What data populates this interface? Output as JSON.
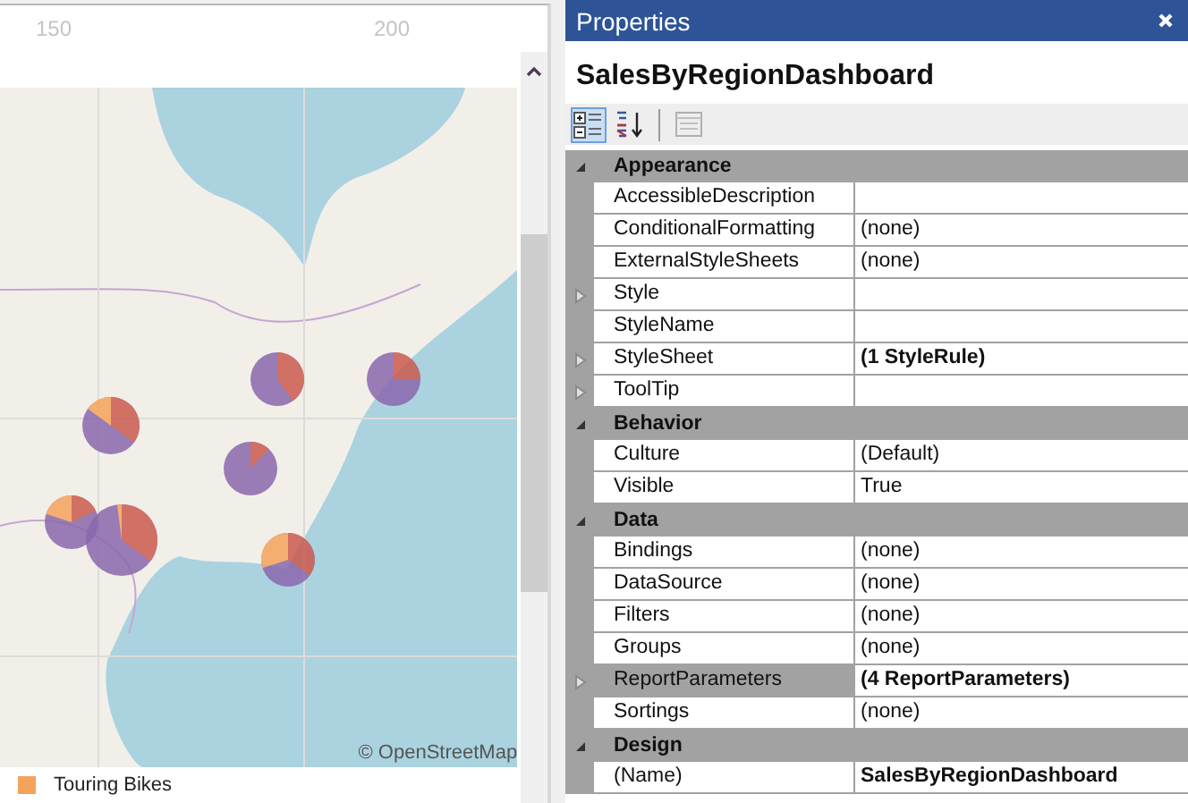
{
  "designer": {
    "ruler_ticks": [
      "150",
      "200"
    ],
    "map": {
      "kind": "picture",
      "attribution": "© OpenStreetMap"
    },
    "legend": [
      {
        "label": "Touring Bikes",
        "color": "#f5a35c"
      }
    ]
  },
  "properties": {
    "title": "Properties",
    "object_name": "SalesByRegionDashboard",
    "toolbar": [
      {
        "kind": "categorized",
        "selected": true
      },
      {
        "kind": "alphabetical",
        "selected": false
      },
      {
        "kind": "pages",
        "selected": false
      }
    ],
    "categories": [
      {
        "name": "Appearance",
        "expanded": true,
        "properties": [
          {
            "name": "AccessibleDescription",
            "expandable": false,
            "bold": false,
            "selected": false
          },
          {
            "name": "ConditionalFormatting",
            "value": "(none)",
            "expandable": false,
            "bold": false,
            "selected": false
          },
          {
            "name": "ExternalStyleSheets",
            "value": "(none)",
            "expandable": false,
            "bold": false,
            "selected": false
          },
          {
            "name": "Style",
            "expandable": true,
            "bold": false,
            "selected": false
          },
          {
            "name": "StyleName",
            "expandable": false,
            "bold": false,
            "selected": false
          },
          {
            "name": "StyleSheet",
            "value": "(1 StyleRule)",
            "expandable": true,
            "bold": true,
            "selected": false
          },
          {
            "name": "ToolTip",
            "expandable": true,
            "bold": false,
            "selected": false
          }
        ]
      },
      {
        "name": "Behavior",
        "expanded": true,
        "properties": [
          {
            "name": "Culture",
            "value": "(Default)",
            "expandable": false,
            "bold": false,
            "selected": false
          },
          {
            "name": "Visible",
            "value": "True",
            "expandable": false,
            "bold": false,
            "selected": false
          }
        ]
      },
      {
        "name": "Data",
        "expanded": true,
        "properties": [
          {
            "name": "Bindings",
            "value": "(none)",
            "expandable": false,
            "bold": false,
            "selected": false
          },
          {
            "name": "DataSource",
            "value": "(none)",
            "expandable": false,
            "bold": false,
            "selected": false
          },
          {
            "name": "Filters",
            "value": "(none)",
            "expandable": false,
            "bold": false,
            "selected": false
          },
          {
            "name": "Groups",
            "value": "(none)",
            "expandable": false,
            "bold": false,
            "selected": false
          },
          {
            "name": "ReportParameters",
            "value": "(4 ReportParameters)",
            "expandable": true,
            "bold": true,
            "selected": true
          },
          {
            "name": "Sortings",
            "value": "(none)",
            "expandable": false,
            "bold": false,
            "selected": false
          }
        ]
      },
      {
        "name": "Design",
        "expanded": true,
        "properties": [
          {
            "name": "(Name)",
            "value": "SalesByRegionDashboard",
            "expandable": false,
            "bold": true,
            "selected": false
          }
        ]
      }
    ]
  }
}
